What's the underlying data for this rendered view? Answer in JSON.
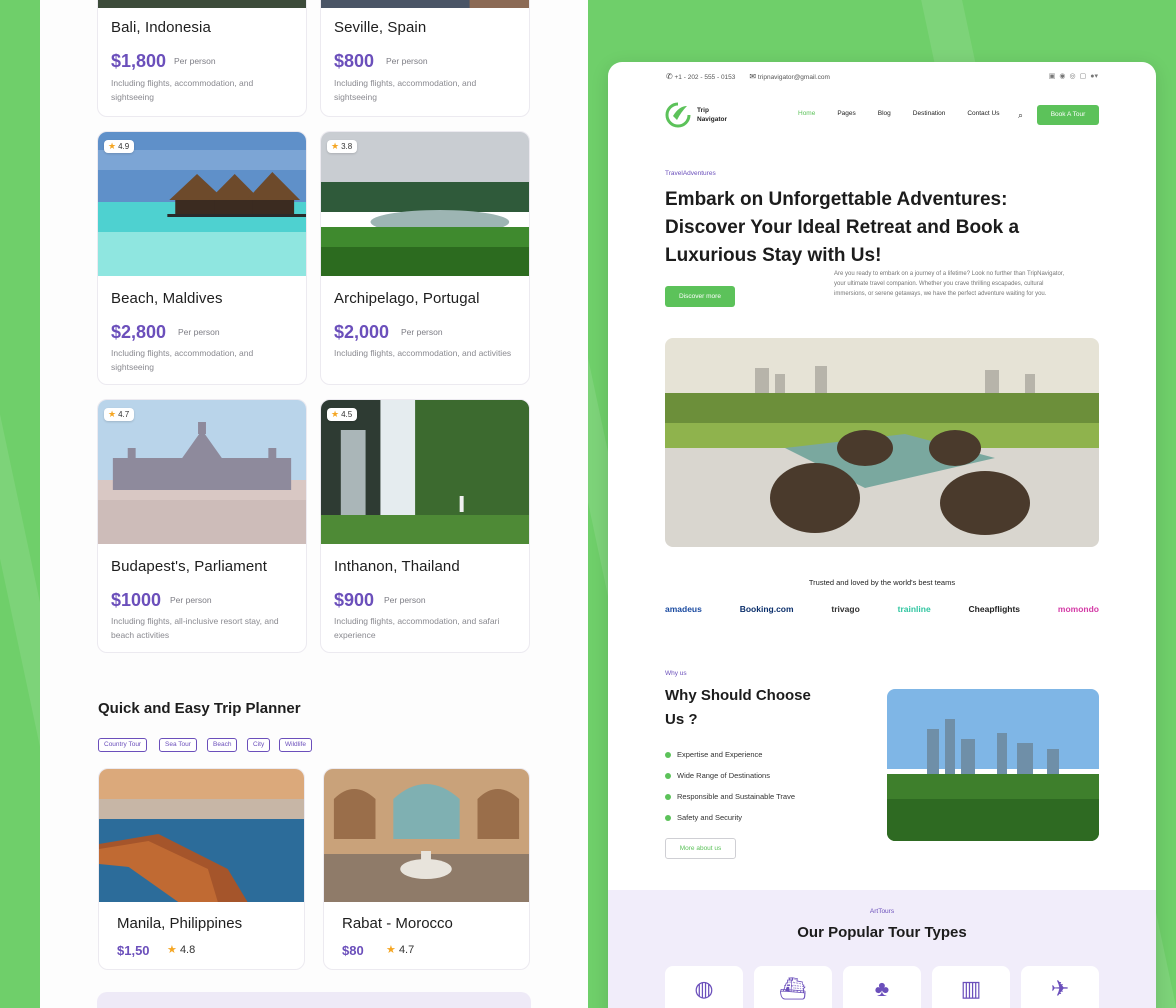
{
  "left": {
    "destinations": [
      {
        "name": "Bali, Indonesia",
        "price": "$1,800",
        "per": "Per person",
        "desc": "Including flights, accommodation, and sightseeing",
        "rating": ""
      },
      {
        "name": "Seville, Spain",
        "price": "$800",
        "per": "Per person",
        "desc": "Including flights, accommodation, and sightseeing",
        "rating": ""
      },
      {
        "name": "Beach, Maldives",
        "price": "$2,800",
        "per": "Per person",
        "desc": "Including flights, accommodation, and sightseeing",
        "rating": "4.9"
      },
      {
        "name": "Archipelago, Portugal",
        "price": "$2,000",
        "per": "Per person",
        "desc": "Including flights, accommodation, and activities",
        "rating": "3.8"
      },
      {
        "name": "Budapest's, Parliament",
        "price": "$1000",
        "per": "Per person",
        "desc": "Including flights, all-inclusive resort stay, and beach activities",
        "rating": "4.7"
      },
      {
        "name": "Inthanon, Thailand",
        "price": "$900",
        "per": "Per person",
        "desc": "Including flights, accommodation, and safari experience",
        "rating": "4.5"
      }
    ],
    "planner": {
      "title": "Quick and Easy Trip Planner",
      "chips": [
        "Country Tour",
        "Sea Tour",
        "Beach",
        "City",
        "Wildlife"
      ],
      "items": [
        {
          "name": "Manila, Philippines",
          "price": "$1,50",
          "rating": "4.8"
        },
        {
          "name": "Rabat - Morocco",
          "price": "$80",
          "rating": "4.7"
        }
      ]
    }
  },
  "right": {
    "topbar": {
      "phone": "+1 - 202 - 555 - 0153",
      "email": "tripnavigator@gmail.com"
    },
    "logo": {
      "line1": "Trip",
      "line2": "Navigator"
    },
    "nav": [
      "Home",
      "Pages",
      "Blog",
      "Destination",
      "Contact Us"
    ],
    "book_label": "Book A Tour",
    "hero": {
      "eyebrow": "TravelAdventures",
      "title": "Embark on Unforgettable Adventures: Discover Your Ideal Retreat and Book a Luxurious Stay with Us!",
      "desc": "Are you ready to embark on a journey of a lifetime? Look no further than TripNavigator, your ultimate travel companion. Whether you crave thrilling escapades, cultural immersions, or serene getaways, we have the perfect adventure waiting for you.",
      "button": "Discover more"
    },
    "trusted": "Trusted and loved by the world's best teams",
    "brands": [
      {
        "name": "amadeus",
        "color": "#1a4aa0"
      },
      {
        "name": "Booking.com",
        "color": "#0b2f6b"
      },
      {
        "name": "trivago",
        "color": "#333333"
      },
      {
        "name": "trainline",
        "color": "#2fc5a0"
      },
      {
        "name": "Cheapflights",
        "color": "#222222"
      },
      {
        "name": "momondo",
        "color": "#d43aa6"
      }
    ],
    "why": {
      "eyebrow": "Why us",
      "title": "Why Should Choose Us ?",
      "items": [
        "Expertise and Experience",
        "Wide Range of Destinations",
        "Responsible and Sustainable Trave",
        "Safety and Security"
      ],
      "button": "More about us"
    },
    "tours": {
      "eyebrow": "ArtTours",
      "title": "Our Popular Tour Types"
    }
  }
}
